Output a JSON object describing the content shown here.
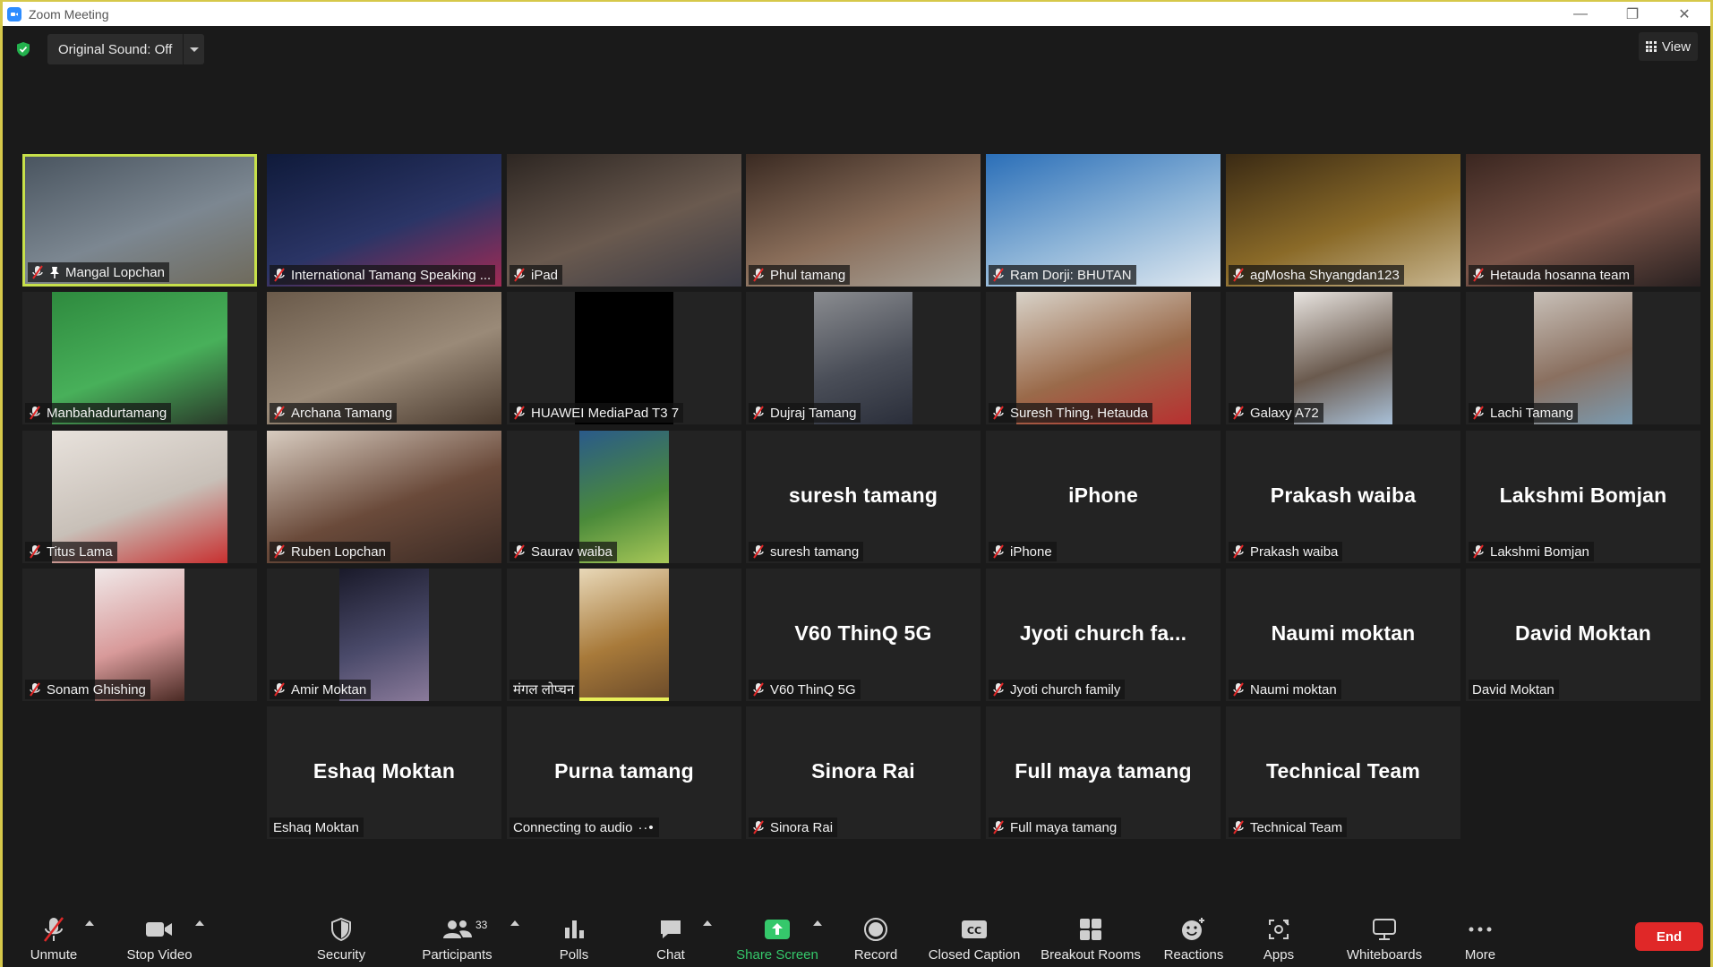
{
  "window": {
    "title": "Zoom Meeting",
    "controls": {
      "minimize": "—",
      "restore": "❐",
      "close": "✕"
    }
  },
  "topbar": {
    "original_sound": "Original Sound: Off",
    "view_label": "View"
  },
  "tiles": [
    {
      "label": "Mangal Lopchan",
      "big": "",
      "muted": true,
      "pinned": true,
      "active": true,
      "video": true,
      "colors": [
        "#4a5560",
        "#7c8791",
        "#6f6a5b"
      ]
    },
    {
      "label": "International Tamang Speaking ...",
      "big": "",
      "muted": true,
      "video": true,
      "colors": [
        "#0f1a3a",
        "#2b3566",
        "#a12a54"
      ]
    },
    {
      "label": "iPad",
      "big": "",
      "muted": true,
      "video": true,
      "colors": [
        "#2d2622",
        "#6a5a4f",
        "#3a3a44"
      ]
    },
    {
      "label": "Phul tamang",
      "big": "",
      "muted": true,
      "video": true,
      "colors": [
        "#3a2a22",
        "#8a6e5a",
        "#a8a39a"
      ]
    },
    {
      "label": "Ram Dorji: BHUTAN",
      "big": "",
      "muted": true,
      "video": true,
      "colors": [
        "#2b6fb8",
        "#8eb5d8",
        "#dfe8f0"
      ]
    },
    {
      "label": "agMosha Shyangdan123",
      "big": "",
      "muted": true,
      "video": true,
      "colors": [
        "#3a2a14",
        "#8a6a28",
        "#c8b690"
      ]
    },
    {
      "label": "Hetauda hosanna team",
      "big": "",
      "muted": true,
      "video": true,
      "colors": [
        "#3a2620",
        "#7a5448",
        "#282020"
      ]
    },
    {
      "label": "Manbahadurtamang",
      "big": "",
      "muted": true,
      "video": true,
      "colors": [
        "#2e8a3e",
        "#48b05a",
        "#2a3a2a"
      ]
    },
    {
      "label": "Archana Tamang",
      "big": "",
      "muted": true,
      "video": true,
      "colors": [
        "#6a5a4a",
        "#9a8a78",
        "#4a3a2e"
      ]
    },
    {
      "label": "HUAWEI MediaPad T3 7",
      "big": "",
      "muted": true,
      "video": true,
      "colors": [
        "#000000",
        "#000000",
        "#000000"
      ]
    },
    {
      "label": "Dujraj Tamang",
      "big": "",
      "muted": true,
      "video": true,
      "colors": [
        "#8a8c90",
        "#4a4e58",
        "#2a2e3a"
      ]
    },
    {
      "label": "Suresh Thing, Hetauda",
      "big": "",
      "muted": true,
      "video": true,
      "colors": [
        "#d8d2c8",
        "#9a6a4a",
        "#b83030"
      ]
    },
    {
      "label": "Galaxy A72",
      "big": "",
      "muted": true,
      "video": true,
      "colors": [
        "#e8e4e0",
        "#6a5a4e",
        "#a8c0d8"
      ]
    },
    {
      "label": "Lachi Tamang",
      "big": "",
      "muted": true,
      "video": true,
      "colors": [
        "#c8c0b8",
        "#8a7060",
        "#7a9ab0"
      ]
    },
    {
      "label": "Titus Lama",
      "big": "",
      "muted": true,
      "video": true,
      "colors": [
        "#e8e2dc",
        "#c8c0b8",
        "#c83030"
      ]
    },
    {
      "label": "Ruben Lopchan",
      "big": "",
      "muted": true,
      "video": true,
      "colors": [
        "#d8ccc0",
        "#6a4a3a",
        "#3a2a24"
      ]
    },
    {
      "label": "Saurav waiba",
      "big": "",
      "muted": true,
      "video": true,
      "colors": [
        "#2a5a8a",
        "#4a8a3a",
        "#a8c858"
      ]
    },
    {
      "label": "suresh tamang",
      "big": "suresh tamang",
      "muted": true,
      "video": false
    },
    {
      "label": "iPhone",
      "big": "iPhone",
      "muted": true,
      "video": false
    },
    {
      "label": "Prakash waiba",
      "big": "Prakash waiba",
      "muted": true,
      "video": false
    },
    {
      "label": "Lakshmi Bomjan",
      "big": "Lakshmi Bomjan",
      "muted": true,
      "video": false
    },
    {
      "label": "Sonam Ghishing",
      "big": "",
      "muted": true,
      "video": true,
      "colors": [
        "#f0e8e8",
        "#d89a9a",
        "#4a2a24"
      ]
    },
    {
      "label": "Amir Moktan",
      "big": "",
      "muted": true,
      "video": true,
      "colors": [
        "#1a1a2a",
        "#4a4a6a",
        "#8a7a9a"
      ]
    },
    {
      "label": "मंगल लोप्चन",
      "big": "",
      "muted": false,
      "video": true,
      "speaking": true,
      "colors": [
        "#e8d8b8",
        "#a87a3a",
        "#6a4a2a"
      ]
    },
    {
      "label": "V60 ThinQ 5G",
      "big": "V60 ThinQ 5G",
      "muted": true,
      "video": false
    },
    {
      "label": "Jyoti church family",
      "big": "Jyoti church fa...",
      "muted": true,
      "video": false
    },
    {
      "label": "Naumi moktan",
      "big": "Naumi moktan",
      "muted": true,
      "video": false
    },
    {
      "label": "David Moktan",
      "big": "David Moktan",
      "muted": false,
      "video": false
    },
    {
      "label": "Eshaq Moktan",
      "big": "Eshaq Moktan",
      "muted": false,
      "video": false
    },
    {
      "label": "Connecting to audio",
      "big": "Purna tamang",
      "muted": false,
      "video": false,
      "connecting": true
    },
    {
      "label": "Sinora Rai",
      "big": "Sinora Rai",
      "muted": true,
      "video": false
    },
    {
      "label": "Full maya tamang",
      "big": "Full maya tamang",
      "muted": true,
      "video": false
    },
    {
      "label": "Technical Team",
      "big": "Technical Team",
      "muted": true,
      "video": false
    }
  ],
  "toolbar": {
    "unmute": "Unmute",
    "stop_video": "Stop Video",
    "security": "Security",
    "participants": "Participants",
    "participants_count": "33",
    "polls": "Polls",
    "chat": "Chat",
    "share_screen": "Share Screen",
    "record": "Record",
    "closed_caption": "Closed Caption",
    "breakout_rooms": "Breakout Rooms",
    "reactions": "Reactions",
    "apps": "Apps",
    "whiteboards": "Whiteboards",
    "more": "More",
    "end": "End"
  },
  "colors": {
    "active_speaker": "#c7e04a",
    "share_green": "#35c86b",
    "end_red": "#e02828"
  }
}
